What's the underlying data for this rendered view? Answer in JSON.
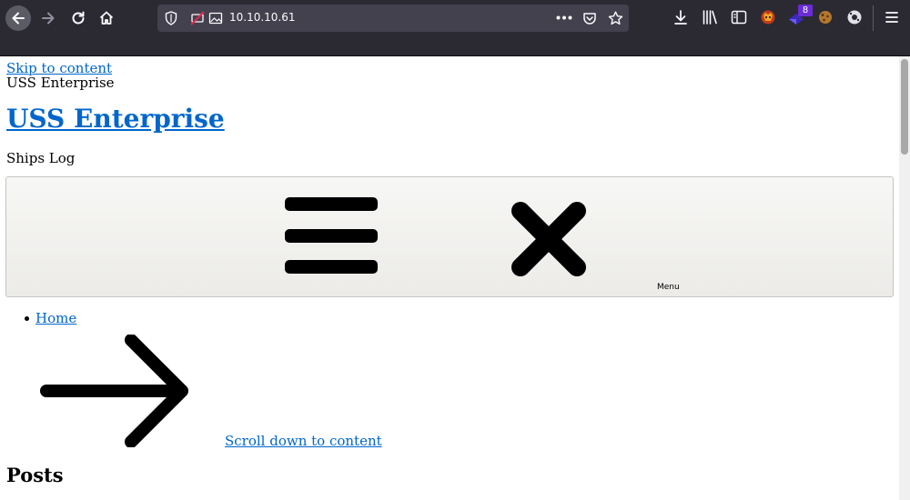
{
  "browser": {
    "url": "10.10.10.61",
    "extension_badge_count": "8",
    "toolbar_icons": [
      "back-icon",
      "forward-icon",
      "reload-icon",
      "home-icon",
      "shield-icon",
      "blocked-media-icon",
      "image-icon",
      "more-icon",
      "pocket-icon",
      "star-icon",
      "download-icon",
      "library-icon",
      "sidebar-icon",
      "extension-fox-icon",
      "extension-badge-icon",
      "cookie-icon",
      "extension-gear-icon",
      "menu-icon"
    ]
  },
  "page": {
    "skip_link": "Skip to content",
    "site_name": "USS Enterprise",
    "site_title": "USS Enterprise",
    "tagline": "Ships Log",
    "menu_button_label": "Menu",
    "nav_items": [
      {
        "label": "Home"
      }
    ],
    "scroll_link": "Scroll down to content",
    "posts_heading": "Posts"
  },
  "colors": {
    "chrome_bg": "#2b2a33",
    "urlbar_bg": "#42414d",
    "link": "#0066cc",
    "badge": "#6c2bd9"
  }
}
